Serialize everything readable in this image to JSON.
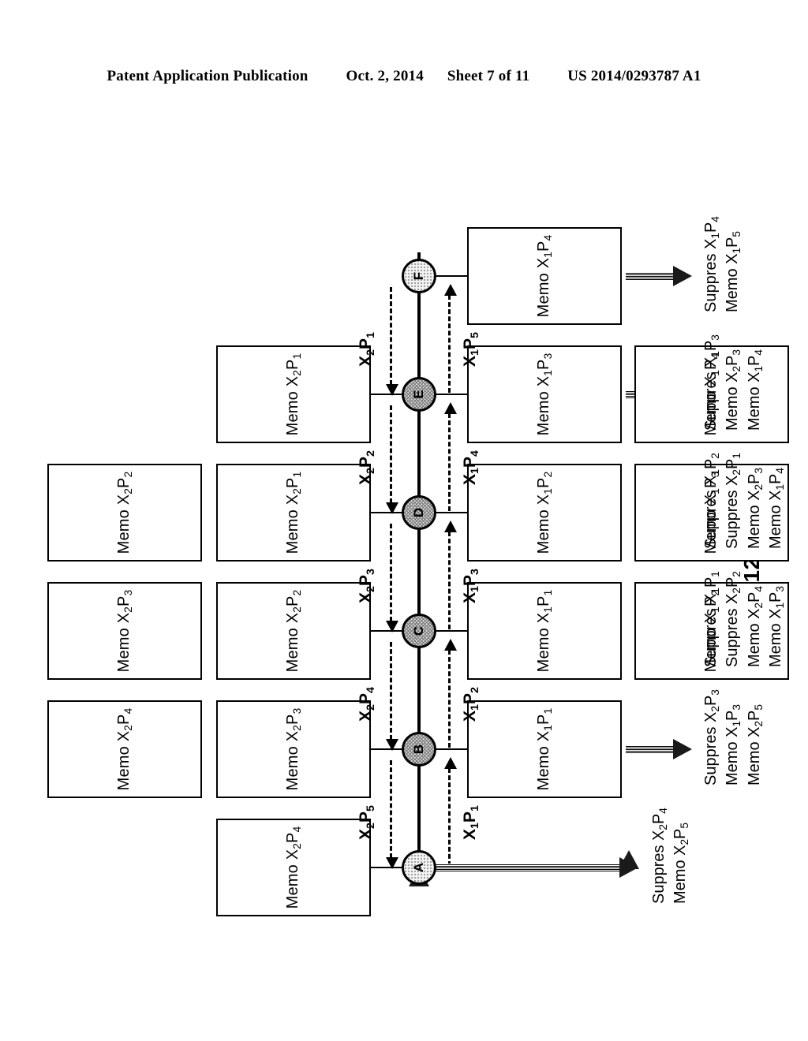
{
  "header": {
    "left": "Patent Application Publication",
    "date": "Oct. 2, 2014",
    "sheet": "Sheet 7 of 11",
    "docnum": "US 2014/0293787 A1"
  },
  "figure": {
    "caption": "FIG.12"
  },
  "nodes": [
    {
      "id": "A",
      "label": "A",
      "fill": "light"
    },
    {
      "id": "B",
      "label": "B",
      "fill": "dark"
    },
    {
      "id": "C",
      "label": "C",
      "fill": "dark"
    },
    {
      "id": "D",
      "label": "D",
      "fill": "dark"
    },
    {
      "id": "E",
      "label": "E",
      "fill": "dark"
    },
    {
      "id": "F",
      "label": "F",
      "fill": "light"
    }
  ],
  "memos": {
    "a_upper": "Memo X2P4",
    "b_upper_far": "Memo X2P4",
    "b_upper_near": "Memo X2P3",
    "c_upper_far": "Memo X2P3",
    "c_upper_near": "Memo X2P2",
    "d_upper_far": "Memo X2P2",
    "d_upper_near": "Memo X2P1",
    "e_upper": "Memo X2P1",
    "b_lower": "Memo X1P1",
    "c_lower_near": "Memo X1P1",
    "c_lower_far": "Memo X1P2",
    "d_lower_near": "Memo X1P2",
    "d_lower_far": "Memo X1P3",
    "e_lower_near": "Memo X1P3",
    "e_lower_far": "Memo X1P4",
    "f_lower": "Memo X1P4"
  },
  "edge_labels": {
    "ab_up": "X2P5",
    "ab_down": "X1P1",
    "bc_up": "X2P4",
    "bc_down": "X1P2",
    "cd_up": "X2P3",
    "cd_down": "X1P3",
    "de_up": "X2P2",
    "de_down": "X1P4",
    "ef_up": "X2P1",
    "ef_down": "X1P5"
  },
  "outputs": {
    "a": [
      "Suppres X2P4",
      "Memo X2P5"
    ],
    "b": [
      "Suppres X2P3",
      "Memo X1P3",
      "Memo X2P5"
    ],
    "c": [
      "Suppres X1P1",
      "Suppres X2P2",
      "Memo X2P4",
      "Memo X1P3"
    ],
    "d": [
      "Suppres X1P2",
      "Suppres X2P1",
      "Memo X2P3",
      "Memo X1P4"
    ],
    "e": [
      "Suppres X1P3",
      "Memo X2P3",
      "Memo X1P4"
    ],
    "f": [
      "Suppres X1P4",
      "Memo X1P5"
    ]
  },
  "colors": {
    "ink": "#000000",
    "paper": "#ffffff",
    "node_light": "#f2f2f2",
    "node_dark": "#d8d8d8"
  }
}
